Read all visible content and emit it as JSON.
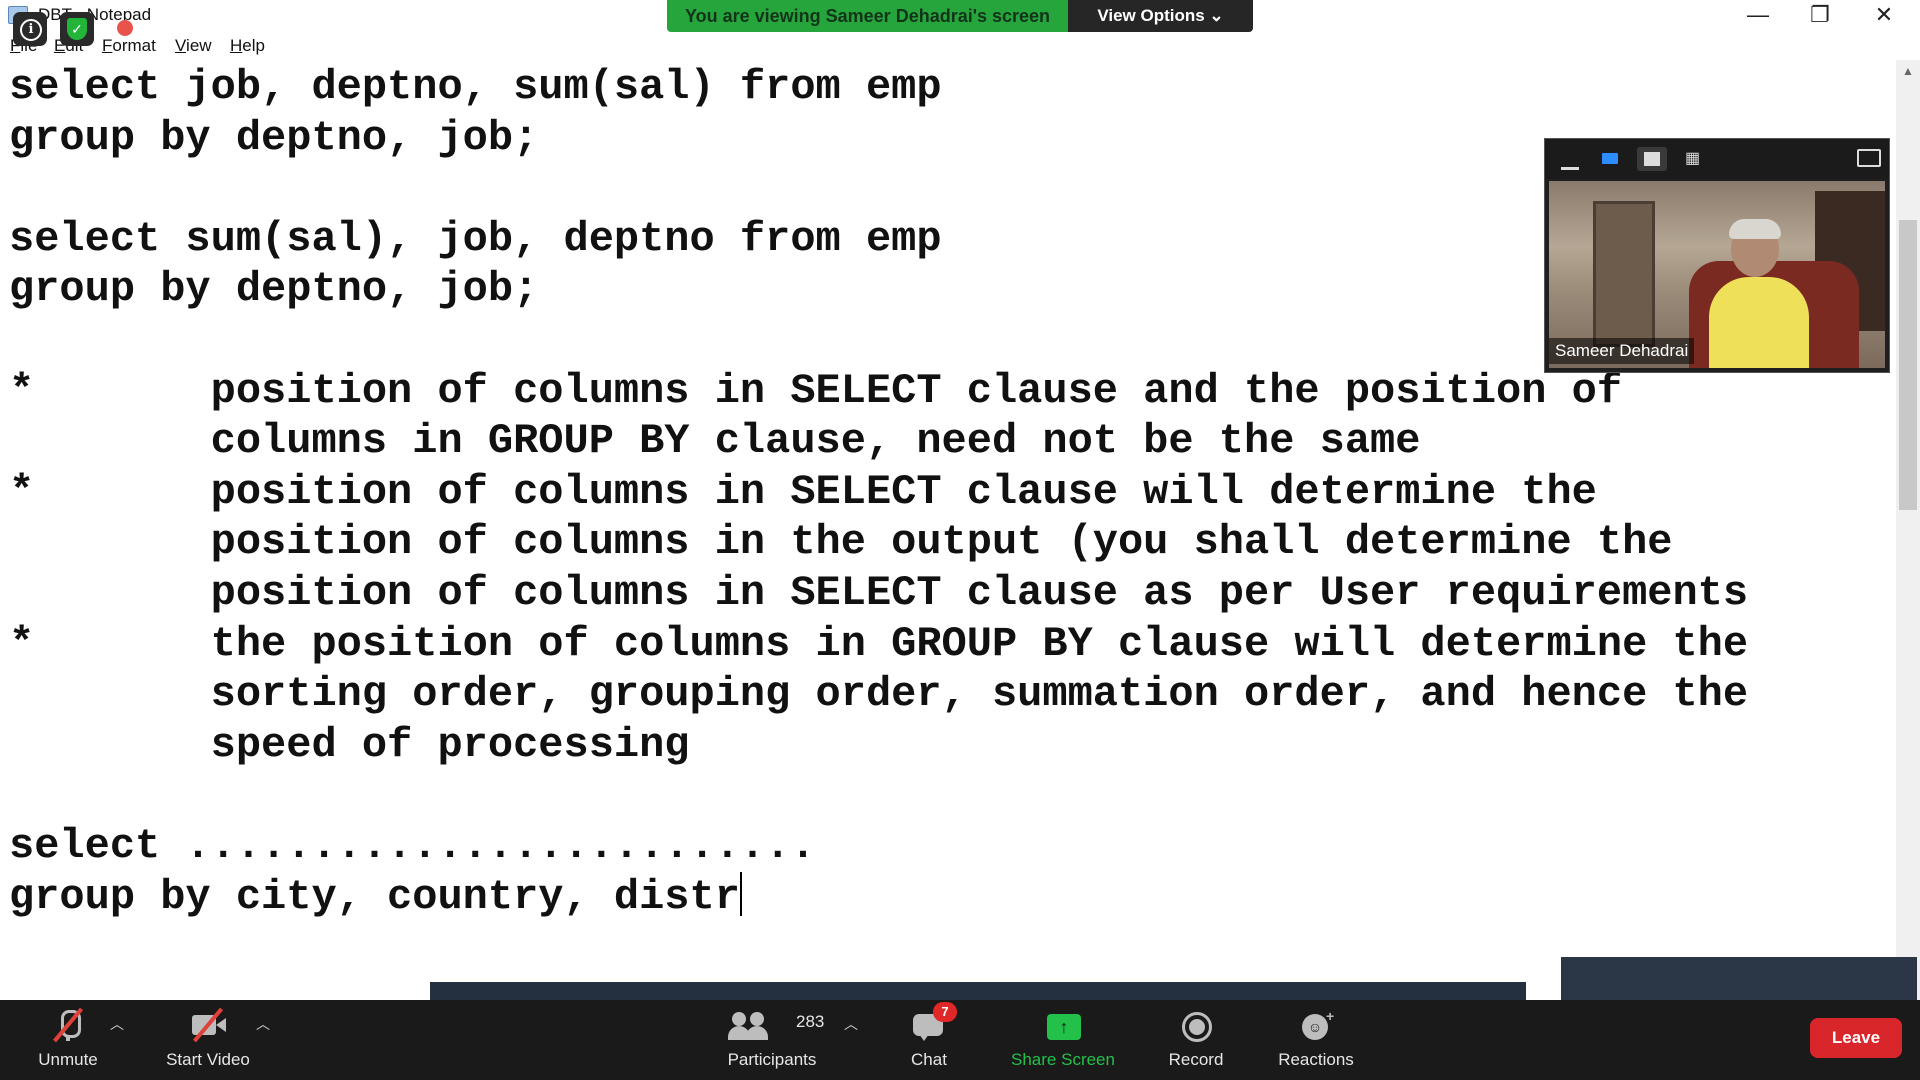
{
  "notepad": {
    "title": "DBT - Notepad",
    "menu": {
      "file_u": "F",
      "file_rest": "ile",
      "edit_u": "E",
      "edit_rest": "dit",
      "format_u": "F",
      "format_pre": "",
      "format_rest": "ormat",
      "view_u": "V",
      "view_rest": "iew",
      "help_u": "H",
      "help_rest": "elp"
    },
    "content": "select job, deptno, sum(sal) from emp\ngroup by deptno, job;\n\nselect sum(sal), job, deptno from emp\ngroup by deptno, job;\n\n*       position of columns in SELECT clause and the position of\n        columns in GROUP BY clause, need not be the same\n*       position of columns in SELECT clause will determine the\n        position of columns in the output (you shall determine the\n        position of columns in SELECT clause as per User requirements\n*       the position of columns in GROUP BY clause will determine the\n        sorting order, grouping order, summation order, and hence the\n        speed of processing\n\nselect .........................\ngroup by city, country, distr"
  },
  "banner": {
    "viewing": "You are viewing Sameer Dehadrai's screen",
    "view_options": "View Options ⌄"
  },
  "window_controls": {
    "minimize": "—",
    "restore": "❐",
    "close": "✕"
  },
  "video": {
    "name": "Sameer Dehadrai"
  },
  "toolbar": {
    "unmute": "Unmute",
    "start_video": "Start Video",
    "participants": "Participants",
    "participants_count": "283",
    "chat": "Chat",
    "chat_badge": "7",
    "share_screen": "Share Screen",
    "record": "Record",
    "reactions": "Reactions",
    "leave": "Leave"
  },
  "colors": {
    "share_green": "#23c04a",
    "leave_red": "#d8262b",
    "banner_green": "#26a53c",
    "toolbar_bg": "#1a1a1a"
  }
}
